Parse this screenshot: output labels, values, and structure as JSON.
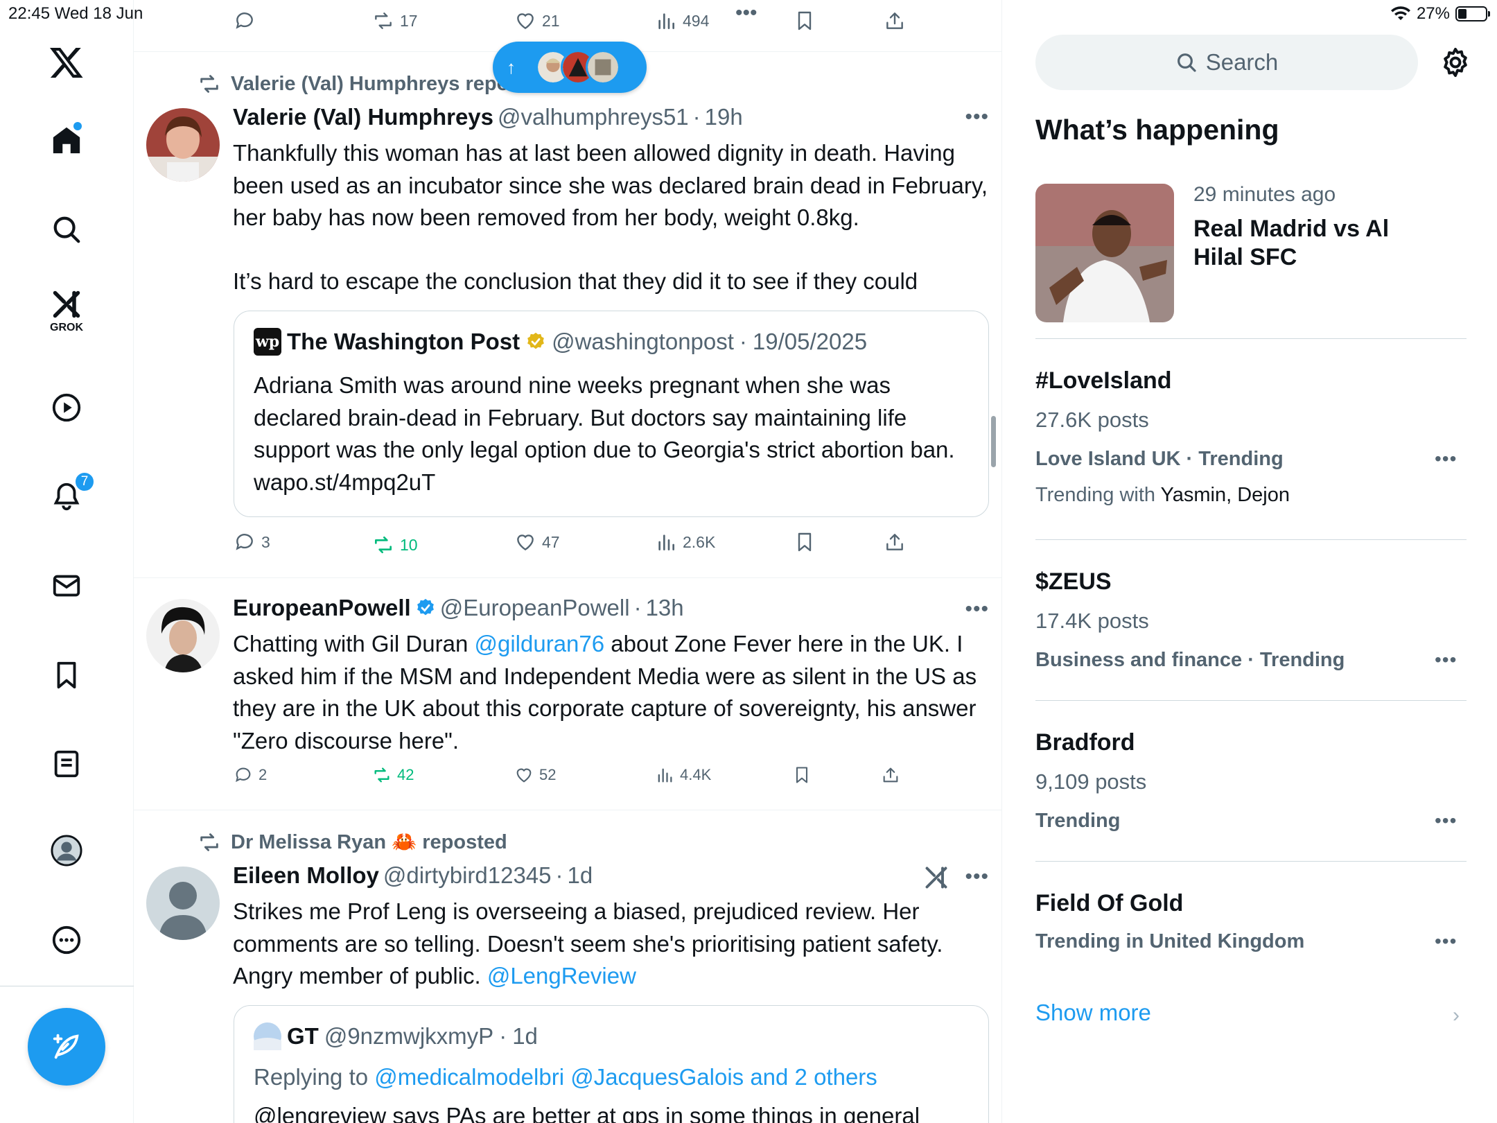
{
  "status_bar": {
    "time_date": "22:45  Wed 18 Jun",
    "battery": "27%"
  },
  "nav": {
    "grok_label": "GROK",
    "notifications_count": "7"
  },
  "top_actions": {
    "replies": "",
    "reposts": "17",
    "likes": "21",
    "views": "494",
    "more": "•••"
  },
  "new_posts_pill": {
    "arrow": "↑"
  },
  "tweets": [
    {
      "social_context": "Valerie (Val) Humphreys reposted",
      "name": "Valerie (Val) Humphreys",
      "handle": "@valhumphreys51",
      "time": "19h",
      "text_p1": "Thankfully this woman has at last been allowed dignity in death. Having been used as an incubator since she was declared brain dead in February, her baby has now been removed from her body, weight 0.8kg.",
      "text_p2": "It’s hard to escape the conclusion that they did it to see if they could",
      "quote": {
        "logo": "wp",
        "name": "The Washington Post",
        "handle": "@washingtonpost",
        "time": "19/05/2025",
        "text": "Adriana Smith was around nine weeks pregnant when she was declared brain-dead in February. But doctors say maintaining life support was the only legal option due to Georgia's strict abortion ban. wapo.st/4mpq2uT"
      },
      "stats": {
        "replies": "3",
        "reposts": "10",
        "likes": "47",
        "views": "2.6K"
      }
    },
    {
      "name": "EuropeanPowell",
      "handle": "@EuropeanPowell",
      "time": "13h",
      "text_a": "Chatting with Gil Duran ",
      "text_link": "@gilduran76",
      "text_b": "  about Zone Fever here in the UK. I asked him if the MSM and Independent Media were as silent in the US as they are in the UK about this corporate capture of sovereignty, his answer \"Zero discourse here\".",
      "stats": {
        "replies": "2",
        "reposts": "42",
        "likes": "52",
        "views": "4.4K"
      }
    },
    {
      "social_context": "Dr Melissa Ryan 🦀 reposted",
      "name": "Eileen Molloy",
      "handle": "@dirtybird12345",
      "time": "1d",
      "text_a": "Strikes me Prof Leng is overseeing a biased, prejudiced review. Her comments are so telling. Doesn't seem she's prioritising patient safety. Angry member of public. ",
      "text_link": "@LengReview",
      "quote": {
        "name": "GT",
        "handle": "@9nzmwjkxmyP",
        "time": "1d",
        "replying_to": "Replying to ",
        "replying_links": "@medicalmodelbri @JacquesGalois and 2 others",
        "text": "@lengreview  says PAs are better at gps in some things in general"
      }
    }
  ],
  "sidebar": {
    "search_placeholder": "Search",
    "title": "What’s happening",
    "featured": {
      "time": "29 minutes ago",
      "headline": "Real Madrid vs Al Hilal SFC"
    },
    "trends": [
      {
        "name": "#LoveIsland",
        "posts": "27.6K posts",
        "category": "Love Island UK · Trending",
        "with_label": "Trending with ",
        "with_names": "Yasmin, Dejon"
      },
      {
        "name": "$ZEUS",
        "posts": "17.4K posts",
        "category": "Business and finance · Trending"
      },
      {
        "name": "Bradford",
        "posts": "9,109 posts",
        "category": "Trending"
      },
      {
        "name": "Field Of Gold",
        "category": "Trending in United Kingdom"
      }
    ],
    "more_label": "•••",
    "show_more": "Show more",
    "show_more_chevron": "›"
  },
  "colors": {
    "accent": "#1d9bf0",
    "repost_green": "#00ba7c",
    "muted": "#536471",
    "text": "#0f1419"
  }
}
